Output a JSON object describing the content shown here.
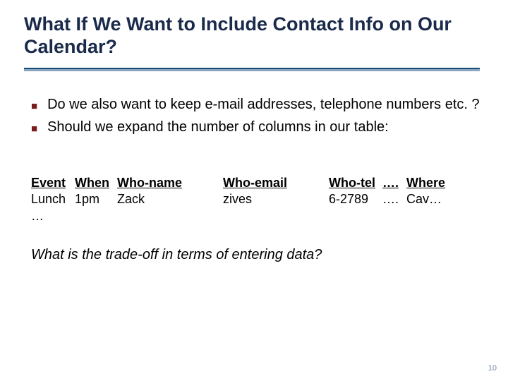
{
  "title": "What If We Want to Include Contact Info on Our Calendar?",
  "bullets": [
    "Do we also want to keep e-mail addresses, telephone numbers etc. ?",
    "Should we expand the number of columns in our table:"
  ],
  "table": {
    "headers": {
      "event": "Event",
      "when": "When",
      "name": "Who-name",
      "email": "Who-email",
      "tel": "Who-tel",
      "dots": "….",
      "where": "Where"
    },
    "row": {
      "event": "Lunch",
      "when": "1pm",
      "name": "Zack",
      "email": "zives",
      "tel": "6-2789",
      "dots": "….",
      "where": "Cav…"
    },
    "ellipsis": "…"
  },
  "question": "What is the trade-off in terms of entering data?",
  "page": "10"
}
